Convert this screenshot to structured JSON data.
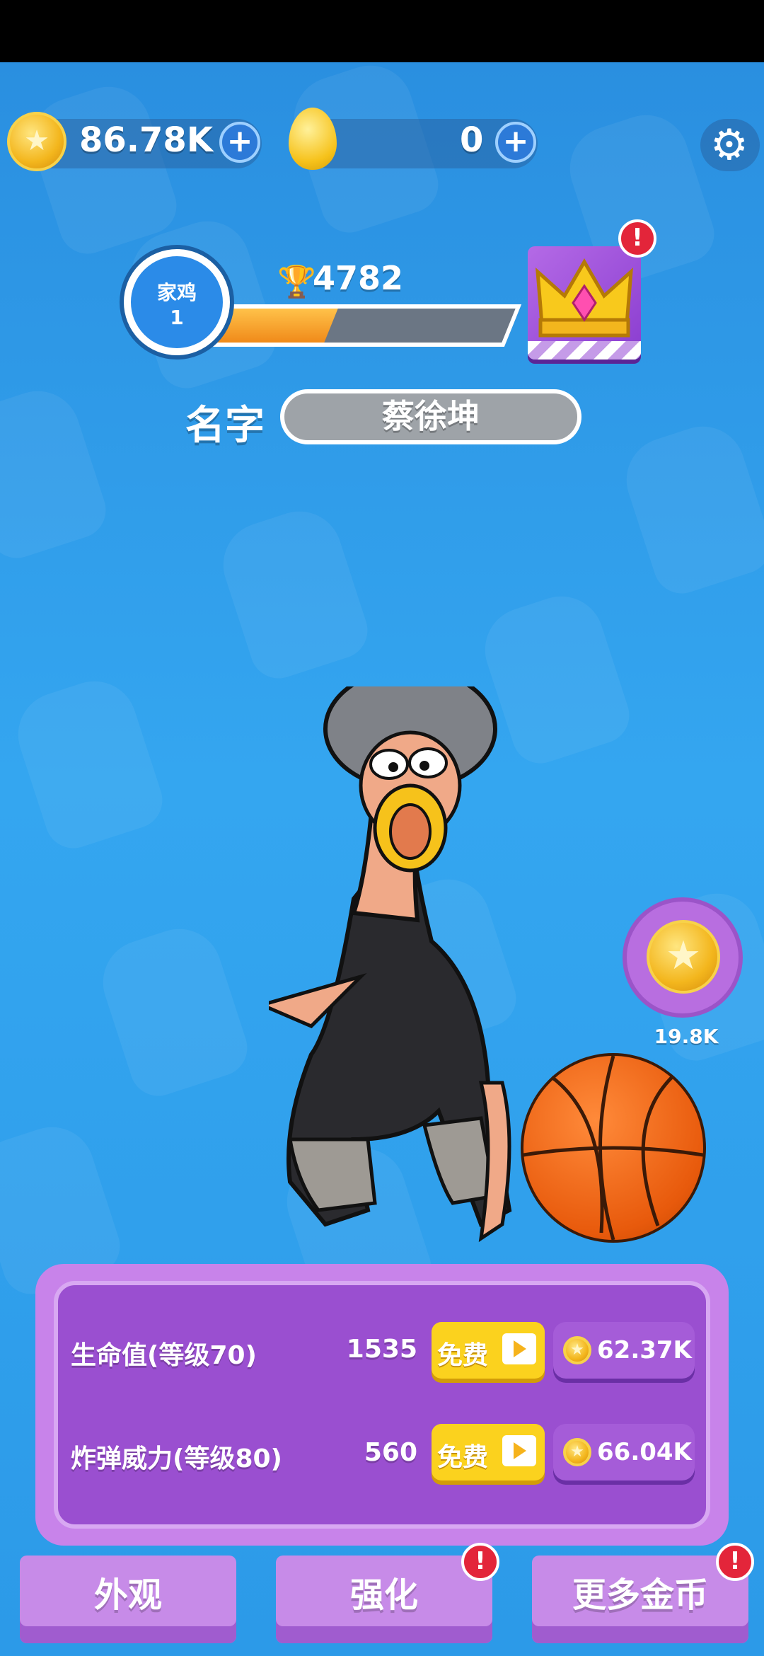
{
  "currency": {
    "coins": "86.78K",
    "eggs": "0",
    "plus_glyph": "+"
  },
  "settings": {
    "icon": "gear-icon",
    "glyph": "⚙"
  },
  "player": {
    "level_name": "家鸡",
    "level_num": "1",
    "trophies": "4782",
    "xp_progress": 0.4,
    "name_label": "名字",
    "name": "蔡徐坤"
  },
  "alerts": {
    "glyph": "!"
  },
  "reward": {
    "value": "19.8K"
  },
  "upgrades": [
    {
      "label": "生命值(等级70)",
      "value": "1535",
      "free": "免费",
      "cost": "62.37K"
    },
    {
      "label": "炸弹威力(等级80)",
      "value": "560",
      "free": "免费",
      "cost": "66.04K"
    }
  ],
  "tabs": [
    {
      "label": "外观"
    },
    {
      "label": "强化"
    },
    {
      "label": "更多金币"
    }
  ],
  "colors": {
    "accent": "#2f9ae6",
    "panel": "#9a4fd0",
    "gold": "#f3b61d",
    "alert": "#e3253a"
  }
}
